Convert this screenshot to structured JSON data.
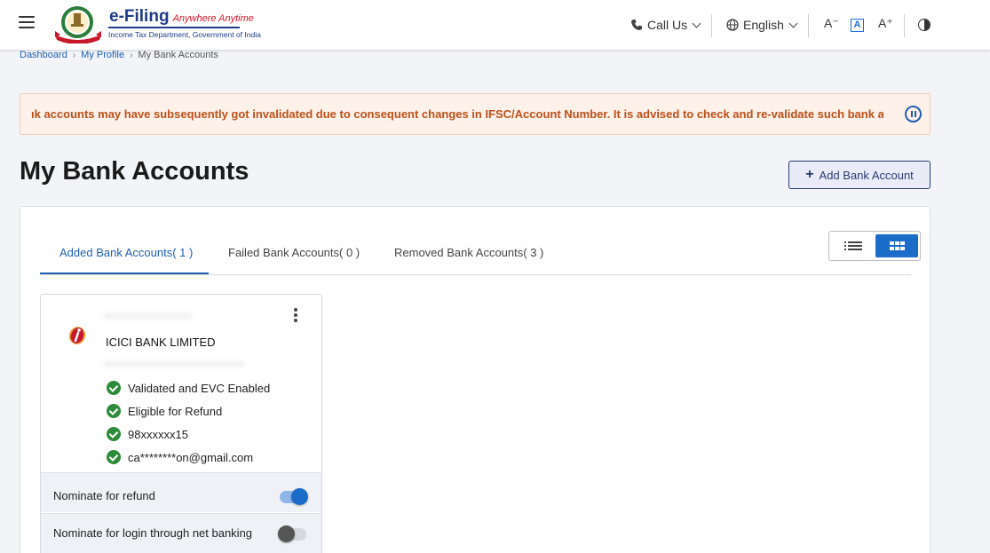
{
  "header": {
    "brand_title": "e-Filing",
    "brand_tagline": "Anywhere Anytime",
    "brand_subtitle": "Income Tax Department, Government of India",
    "call_us": "Call Us",
    "language": "English",
    "font_decrease": "A⁻",
    "font_default": "A",
    "font_increase": "A⁺"
  },
  "breadcrumb": {
    "items": [
      "Dashboard",
      "My Profile",
      "My Bank Accounts"
    ],
    "separator": "›"
  },
  "alert": {
    "text": "ık accounts may have subsequently got invalidated due to consequent changes in IFSC/Account Number. It is advised to check and re-validate such bank accounts wi"
  },
  "page": {
    "title": "My Bank Accounts",
    "add_button": "Add Bank Account"
  },
  "tabs": [
    {
      "label": "Added Bank Accounts( 1 )",
      "active": true
    },
    {
      "label": "Failed Bank Accounts( 0 )",
      "active": false
    },
    {
      "label": "Removed Bank Accounts( 3 )",
      "active": false
    }
  ],
  "view_mode": "grid",
  "card": {
    "bank_name": "ICICI BANK LIMITED",
    "details": [
      "Validated and EVC Enabled",
      "Eligible for Refund",
      "98xxxxxx15",
      "ca********on@gmail.com"
    ],
    "nominate_refund": {
      "label": "Nominate for refund",
      "enabled": true
    },
    "nominate_login": {
      "label": "Nominate for login through net banking",
      "enabled": false
    }
  },
  "colors": {
    "primary": "#1b6bc9",
    "link": "#1f5fae",
    "alert_text": "#c0501a",
    "alert_bg": "#fdf1ea",
    "success": "#2e8b3a"
  }
}
